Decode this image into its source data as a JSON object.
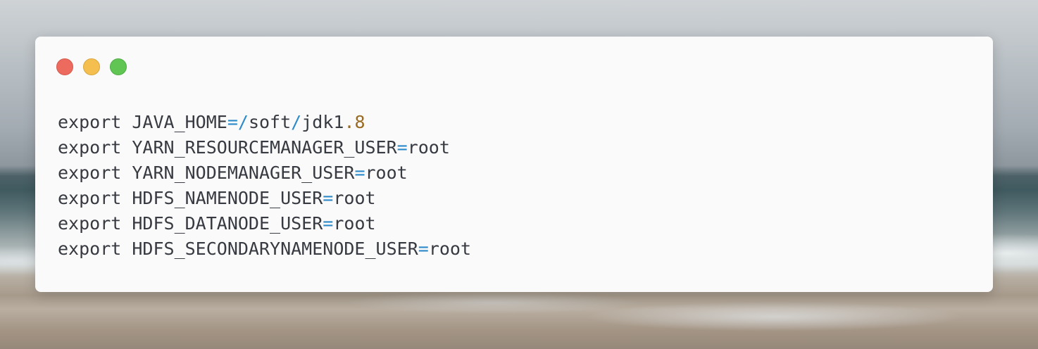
{
  "window": {
    "controls": [
      "close",
      "minimize",
      "maximize"
    ]
  },
  "code": {
    "lines": [
      {
        "tokens": [
          {
            "text": "export JAVA_HOME",
            "kind": "plain"
          },
          {
            "text": "=",
            "kind": "op"
          },
          {
            "text": "/",
            "kind": "op"
          },
          {
            "text": "soft",
            "kind": "plain"
          },
          {
            "text": "/",
            "kind": "op"
          },
          {
            "text": "jdk1",
            "kind": "plain"
          },
          {
            "text": ".8",
            "kind": "num"
          }
        ]
      },
      {
        "tokens": [
          {
            "text": "export YARN_RESOURCEMANAGER_USER",
            "kind": "plain"
          },
          {
            "text": "=",
            "kind": "op"
          },
          {
            "text": "root",
            "kind": "plain"
          }
        ]
      },
      {
        "tokens": [
          {
            "text": "export YARN_NODEMANAGER_USER",
            "kind": "plain"
          },
          {
            "text": "=",
            "kind": "op"
          },
          {
            "text": "root",
            "kind": "plain"
          }
        ]
      },
      {
        "tokens": [
          {
            "text": "export HDFS_NAMENODE_USER",
            "kind": "plain"
          },
          {
            "text": "=",
            "kind": "op"
          },
          {
            "text": "root",
            "kind": "plain"
          }
        ]
      },
      {
        "tokens": [
          {
            "text": "export HDFS_DATANODE_USER",
            "kind": "plain"
          },
          {
            "text": "=",
            "kind": "op"
          },
          {
            "text": "root",
            "kind": "plain"
          }
        ]
      },
      {
        "tokens": [
          {
            "text": "export HDFS_SECONDARYNAMENODE_USER",
            "kind": "plain"
          },
          {
            "text": "=",
            "kind": "op"
          },
          {
            "text": "root",
            "kind": "plain"
          }
        ]
      }
    ]
  },
  "colors": {
    "window_bg": "#fafafa",
    "text": "#383a42",
    "operator": "#2d8ac9",
    "number": "#9a6b23",
    "close": "#ec6a5e",
    "minimize": "#f4bf4f",
    "maximize": "#61c554"
  }
}
